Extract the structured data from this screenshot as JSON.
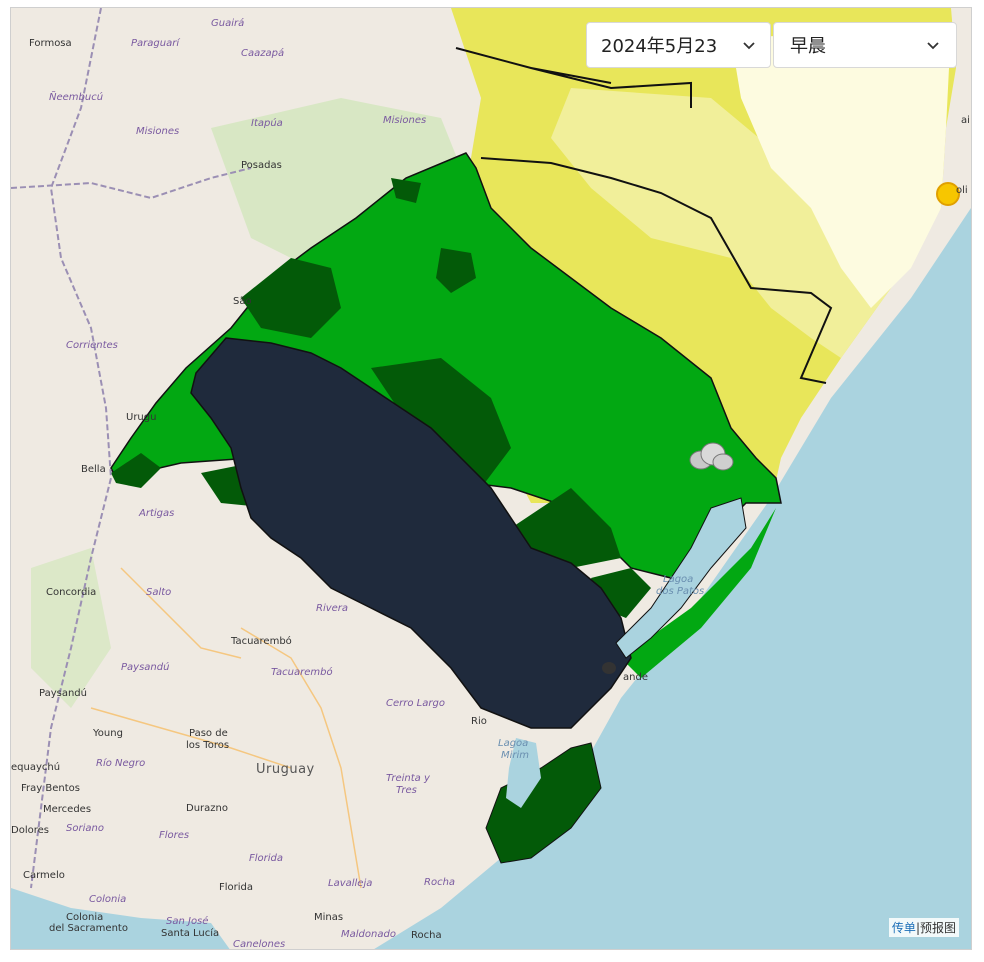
{
  "controls": {
    "date_value": "2024年5月23",
    "period_value": "早晨"
  },
  "attribution": {
    "link": "传单",
    "separator": "|",
    "text": "预报图"
  },
  "legend_colors": {
    "very_low": "#fdfbe0",
    "low": "#f1ef9a",
    "moderate": "#e8e65a",
    "high": "#02a812",
    "very_high": "#035a08",
    "extreme": "#1f2a3c",
    "sea": "#aad3df",
    "land": "#efeae2"
  },
  "places": {
    "formosa": "Formosa",
    "paraguari": "Paraguarí",
    "guaira": "Guairá",
    "caazapa": "Caazapá",
    "neembucu": "Ñeembucú",
    "misiones_py": "Misiones",
    "itapua": "Itapúa",
    "misiones_ar": "Misiones",
    "posadas": "Posadas",
    "corrientes": "Corrientes",
    "sao": "São",
    "urugu": "Urugu",
    "bella": "Bella",
    "artigas": "Artigas",
    "concordia": "Concordia",
    "salto": "Salto",
    "rivera": "Rivera",
    "tacuarembo_city": "Tacuarembó",
    "tacuarembo_dept": "Tacuarembó",
    "paysandu_dept": "Paysandú",
    "paysandu_city": "Paysandú",
    "cerro_largo": "Cerro Largo",
    "young": "Young",
    "paso_de_1": "Paso de",
    "paso_de_2": "los Toros",
    "uruguay": "Uruguay",
    "gualeguaychu": "equaychú",
    "rio_negro": "Río Negro",
    "fray_bentos": "Fray Bentos",
    "mercedes": "Mercedes",
    "dolores": "Dolores",
    "soriano": "Soriano",
    "durazno": "Durazno",
    "flores": "Flores",
    "treinta_1": "Treinta y",
    "treinta_2": "Tres",
    "florida_dept": "Florida",
    "florida_city": "Florida",
    "carmelo": "Carmelo",
    "colonia_dept": "Colonia",
    "colonia_city_1": "Colonia",
    "colonia_city_2": "del Sacramento",
    "lavalleja": "Lavalleja",
    "rocha_dept": "Rocha",
    "minas": "Minas",
    "san_jose": "San José",
    "santa_lucia": "Santa Lucía",
    "canelones": "Canelones",
    "maldonado": "Maldonado",
    "rocha_city": "Rocha",
    "lagoa_patos_1": "Lagoa",
    "lagoa_patos_2": "dos Patos",
    "lagoa_mirim_1": "Lagoa",
    "lagoa_mirim_2": "Mirim",
    "rio_grande": "ande",
    "rio": "Rio",
    "floripa": "oli",
    "ai": "ai"
  }
}
